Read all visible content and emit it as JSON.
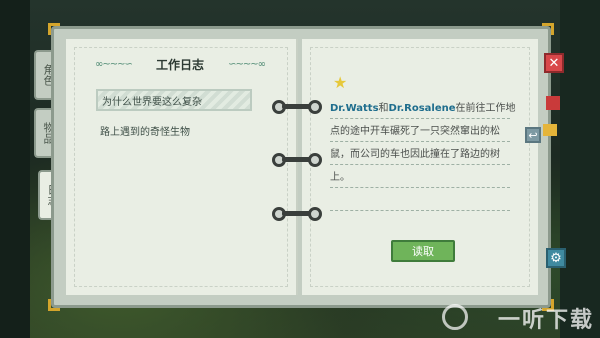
{
  "tabs": [
    {
      "label": "角色"
    },
    {
      "label": "物品"
    },
    {
      "label": "日志"
    }
  ],
  "header": {
    "title": "工作日志",
    "ornament_left": "∞~~~∽",
    "ornament_right": "∽~~~∞"
  },
  "entries": [
    {
      "label": "为什么世界要这么复杂"
    },
    {
      "label": "路上遇到的奇怪生物"
    }
  ],
  "note": {
    "name1": "Dr.Watts",
    "conj": "和",
    "name2": "Dr.Rosalene",
    "text": "在前往工作地点的途中开车碾死了一只突然窜出的松鼠，而公司的车也因此撞在了路边的树上。"
  },
  "buttons": {
    "read": "读取",
    "close_glyph": "✕",
    "back_glyph": "↩",
    "gear_glyph": "⚙"
  },
  "watermark": {
    "text": "一听下载"
  },
  "colors": {
    "accent_green": "#6fb45a",
    "close_red": "#d9474a",
    "corner_gold": "#d4a52c",
    "highlight_name": "#1e6d8d"
  }
}
